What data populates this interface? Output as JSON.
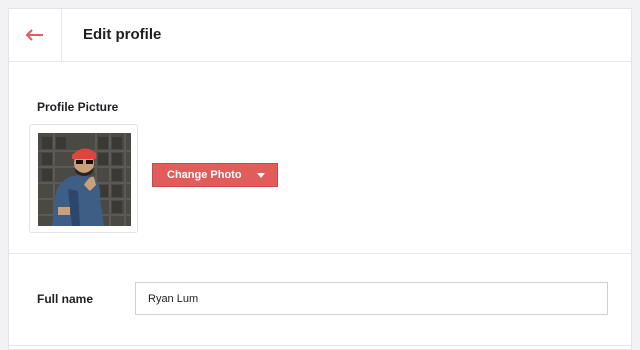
{
  "header": {
    "back_icon": "arrow-left-icon",
    "title": "Edit profile",
    "accent_color": "#e25c5c"
  },
  "profile_picture": {
    "label": "Profile Picture",
    "change_button_label": "Change Photo",
    "button_color": "#e25c5c"
  },
  "full_name": {
    "label": "Full name",
    "value": "Ryan Lum"
  }
}
